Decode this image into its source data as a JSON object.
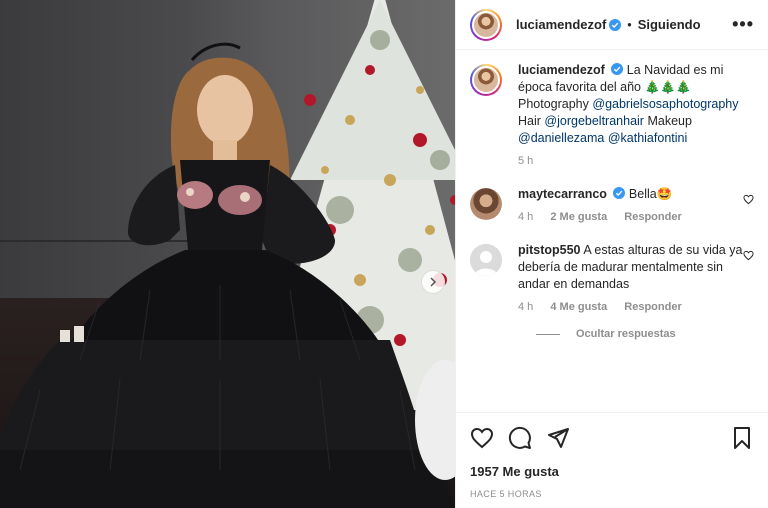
{
  "post": {
    "username": "luciamendezof",
    "follow_status": "Siguiendo",
    "more_label": "•••",
    "caption": {
      "text": "La Navidad es mi época favorita del año 🎄🎄🎄 Photography",
      "mention_photo": "@gabrielsosaphotography",
      "hair_label": "Hair",
      "mention_hair": "@jorgebeltranhair",
      "makeup_label": "Makeup",
      "mention_makeup1": "@daniellezama",
      "mention_makeup2": "@kathiafontini",
      "time": "5 h"
    },
    "comments": [
      {
        "username": "maytecarranco",
        "text": "Bella🤩",
        "time": "4 h",
        "likes": "2 Me gusta",
        "reply": "Responder"
      },
      {
        "username": "pitstop550",
        "text": "A estas alturas de su vida ya debería de madurar mentalmente sin andar en demandas",
        "time": "4 h",
        "likes": "4 Me gusta",
        "reply": "Responder"
      }
    ],
    "hide_replies": "Ocultar respuestas",
    "like_count": "1957 Me gusta",
    "timestamp": "HACE 5 HORAS"
  },
  "icons": {
    "like": "heart-icon",
    "comment": "comment-icon",
    "share": "share-icon",
    "save": "bookmark-icon",
    "verified": "verified-badge-icon",
    "next": "chevron-right-icon",
    "more": "more-options-icon"
  },
  "colors": {
    "text": "#262626",
    "muted": "#8e8e8e",
    "link": "#00376b",
    "verified": "#3897f0"
  }
}
